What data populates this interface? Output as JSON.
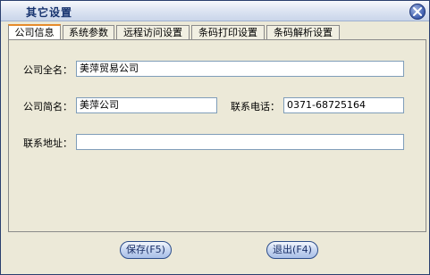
{
  "window": {
    "title": "其它设置"
  },
  "tabs": [
    {
      "label": "公司信息",
      "active": true
    },
    {
      "label": "系统参数",
      "active": false
    },
    {
      "label": "远程访问设置",
      "active": false
    },
    {
      "label": "条码打印设置",
      "active": false
    },
    {
      "label": "条码解析设置",
      "active": false
    }
  ],
  "form": {
    "company_full_name": {
      "label": "公司全名：",
      "value": "美萍贸易公司"
    },
    "company_short_name": {
      "label": "公司简名：",
      "value": "美萍公司"
    },
    "phone": {
      "label": "联系电话：",
      "value": "0371-68725164"
    },
    "address": {
      "label": "联系地址：",
      "value": ""
    }
  },
  "buttons": {
    "save": "保存(F5)",
    "exit": "退出(F4)"
  },
  "icons": {
    "close": "close-icon"
  },
  "colors": {
    "accent_tab": "#e68b2c",
    "title_text": "#16326e",
    "border": "#2a3f6e"
  }
}
